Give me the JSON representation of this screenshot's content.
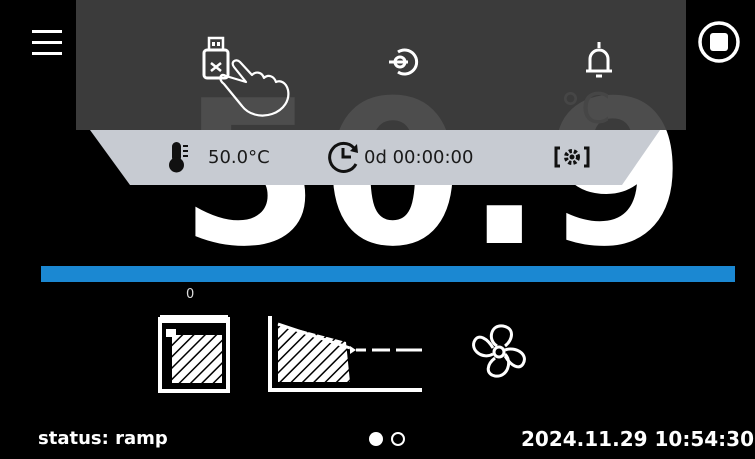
{
  "display": {
    "temperature_big": "50.9",
    "unit": "°C"
  },
  "quick_menu": {
    "icons": [
      "usb-export-icon",
      "login-icon",
      "alarm-bell-icon"
    ]
  },
  "info_strip": {
    "setpoint": "50.0°C",
    "timer": "0d 00:00:00",
    "icons": [
      "thermometer-icon",
      "timer-clock-icon",
      "camera-settings-icon"
    ]
  },
  "program": {
    "segment_counter": "0",
    "icons": [
      "heating-chamber-icon",
      "ramp-profile-icon",
      "fan-icon"
    ],
    "progress_color": "#1b88d2"
  },
  "header": {
    "icons": [
      "menu-icon",
      "stop-icon"
    ]
  },
  "footer": {
    "status": "status: ramp",
    "page_dots": [
      "active",
      "inactive"
    ],
    "datetime": "2024.11.29 10:54:30"
  }
}
